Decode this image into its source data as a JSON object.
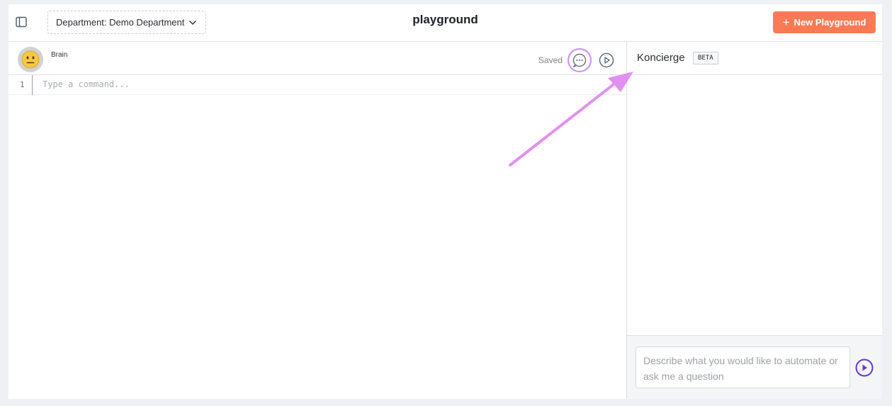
{
  "header": {
    "department_label": "Department: Demo Department",
    "title": "playground",
    "new_button_label": "New Playground",
    "new_button_icon": "plus-icon"
  },
  "editor": {
    "agent_name": "Brain",
    "status": "Saved",
    "line_number": "1",
    "command_placeholder": "Type a command..."
  },
  "koncierge": {
    "title": "Koncierge",
    "badge": "BETA",
    "input_placeholder": "Describe what you would like to automate or ask me a question"
  },
  "colors": {
    "accent": "#f97a55",
    "annotation": "#e290f0",
    "send_icon": "#6a36d9"
  }
}
